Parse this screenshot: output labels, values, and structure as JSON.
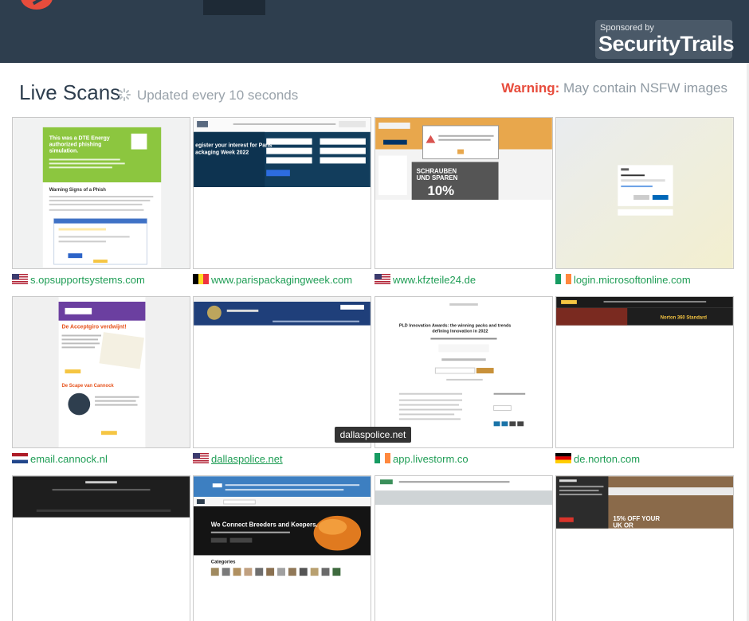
{
  "header": {
    "sponsor_by": "Sponsored by",
    "sponsor_name": "SecurityTrails"
  },
  "scans": {
    "title": "Live Scans",
    "updated": "Updated every 10 seconds",
    "warning_label": "Warning:",
    "warning_text": "May contain NSFW images"
  },
  "tooltip": "dallaspolice.net",
  "results": [
    {
      "domain": "s.opsupportsystems.com",
      "country": "us"
    },
    {
      "domain": "www.parispackagingweek.com",
      "country": "be"
    },
    {
      "domain": "www.kfzteile24.de",
      "country": "us"
    },
    {
      "domain": "login.microsoftonline.com",
      "country": "ie"
    },
    {
      "domain": "email.cannock.nl",
      "country": "nl"
    },
    {
      "domain": "dallaspolice.net",
      "country": "us"
    },
    {
      "domain": "app.livestorm.co",
      "country": "ie"
    },
    {
      "domain": "de.norton.com",
      "country": "de"
    }
  ],
  "screenshots": {
    "dte_title": "This was a DTE Energy authorized phishing simulation.",
    "dte_heading": "Warning Signs of a Phish",
    "paris_heading": "egister your interest for Paris ackaging Week 2022",
    "kfz_promo": "SCHRAUBEN UND SPAREN",
    "kfz_pct": "10%",
    "cannock_h1": "De Acceptgiro verdwijnt!",
    "cannock_h2": "De Scape van Cannock",
    "livestorm_title": "PLD Innovation Awards: the winning packs and trends defining Innovation in 2022",
    "norton_banner": "Norton 360 Standard",
    "breeders": "We Connect Breeders and Keepers.",
    "percent_off": "15% OFF YOUR UK OR"
  }
}
